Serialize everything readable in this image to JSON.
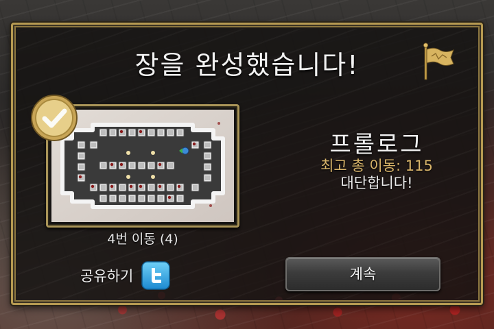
{
  "dialog": {
    "title": "장을 완성했습니다!",
    "flag_icon": "golden-flag-icon",
    "check_icon": "gold-check-badge-icon"
  },
  "level_preview": {
    "caption": "4번 이동 (4)"
  },
  "result": {
    "chapter_name": "프롤로그",
    "best_total_moves": "최고 총 이동: 115",
    "praise": "대단합니다!"
  },
  "share": {
    "label": "공유하기",
    "icon": "twitter-icon"
  },
  "continue_button": {
    "label": "계속"
  },
  "colors": {
    "frame_gold": "#b69a52",
    "highlight_text": "#d9b56a",
    "dialog_bg": "#161413",
    "twitter_blue": "#35aae8"
  }
}
